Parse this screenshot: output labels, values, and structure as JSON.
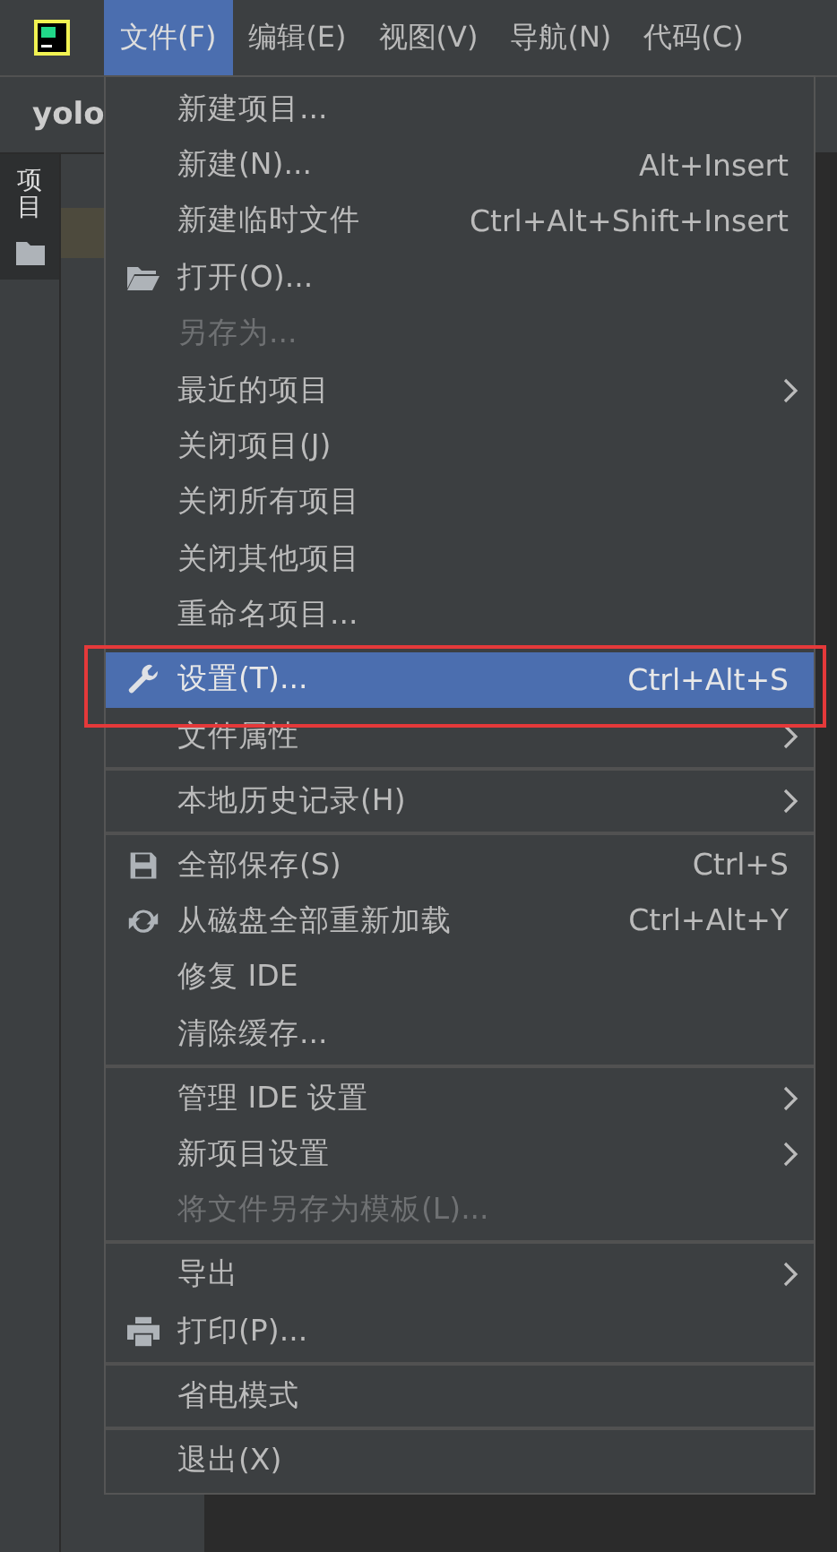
{
  "menu_bar": {
    "items": [
      {
        "label": "文件(F)",
        "selected": true
      },
      {
        "label": "编辑(E)",
        "selected": false
      },
      {
        "label": "视图(V)",
        "selected": false
      },
      {
        "label": "导航(N)",
        "selected": false
      },
      {
        "label": "代码(C)",
        "selected": false
      }
    ]
  },
  "project_title": "yolo",
  "side_tab": {
    "label": "项目"
  },
  "file_menu": {
    "items": [
      {
        "kind": "item",
        "label": "新建项目...",
        "disabled": false,
        "selected": false
      },
      {
        "kind": "item",
        "label": "新建(N)...",
        "shortcut": "Alt+Insert",
        "disabled": false,
        "selected": false
      },
      {
        "kind": "item",
        "label": "新建临时文件",
        "shortcut": "Ctrl+Alt+Shift+Insert",
        "disabled": false,
        "selected": false
      },
      {
        "kind": "folder",
        "label": "打开(O)...",
        "disabled": false,
        "selected": false
      },
      {
        "kind": "item",
        "label": "另存为...",
        "disabled": true,
        "selected": false
      },
      {
        "kind": "item",
        "label": "最近的项目",
        "submenu": true,
        "disabled": false,
        "selected": false
      },
      {
        "kind": "item",
        "label": "关闭项目(J)",
        "disabled": false,
        "selected": false
      },
      {
        "kind": "item",
        "label": "关闭所有项目",
        "disabled": false,
        "selected": false
      },
      {
        "kind": "item",
        "label": "关闭其他项目",
        "disabled": false,
        "selected": false
      },
      {
        "kind": "item",
        "label": "重命名项目...",
        "disabled": false,
        "selected": false
      },
      {
        "kind": "separator"
      },
      {
        "kind": "wrench",
        "label": "设置(T)...",
        "shortcut": "Ctrl+Alt+S",
        "disabled": false,
        "selected": true
      },
      {
        "kind": "item",
        "label": "文件属性",
        "submenu": true,
        "disabled": false,
        "selected": false
      },
      {
        "kind": "separator"
      },
      {
        "kind": "item",
        "label": "本地历史记录(H)",
        "submenu": true,
        "disabled": false,
        "selected": false
      },
      {
        "kind": "separator"
      },
      {
        "kind": "save",
        "label": "全部保存(S)",
        "shortcut": "Ctrl+S",
        "disabled": false,
        "selected": false
      },
      {
        "kind": "reload",
        "label": "从磁盘全部重新加载",
        "shortcut": "Ctrl+Alt+Y",
        "disabled": false,
        "selected": false
      },
      {
        "kind": "item",
        "label": "修复 IDE",
        "disabled": false,
        "selected": false
      },
      {
        "kind": "item",
        "label": "清除缓存...",
        "disabled": false,
        "selected": false
      },
      {
        "kind": "separator"
      },
      {
        "kind": "item",
        "label": "管理 IDE 设置",
        "submenu": true,
        "disabled": false,
        "selected": false
      },
      {
        "kind": "item",
        "label": "新项目设置",
        "submenu": true,
        "disabled": false,
        "selected": false
      },
      {
        "kind": "item",
        "label": "将文件另存为模板(L)...",
        "disabled": true,
        "selected": false
      },
      {
        "kind": "separator"
      },
      {
        "kind": "item",
        "label": "导出",
        "submenu": true,
        "disabled": false,
        "selected": false
      },
      {
        "kind": "printer",
        "label": "打印(P)...",
        "disabled": false,
        "selected": false
      },
      {
        "kind": "separator"
      },
      {
        "kind": "item",
        "label": "省电模式",
        "disabled": false,
        "selected": false
      },
      {
        "kind": "separator"
      },
      {
        "kind": "item",
        "label": "退出(X)",
        "disabled": false,
        "selected": false
      }
    ]
  }
}
